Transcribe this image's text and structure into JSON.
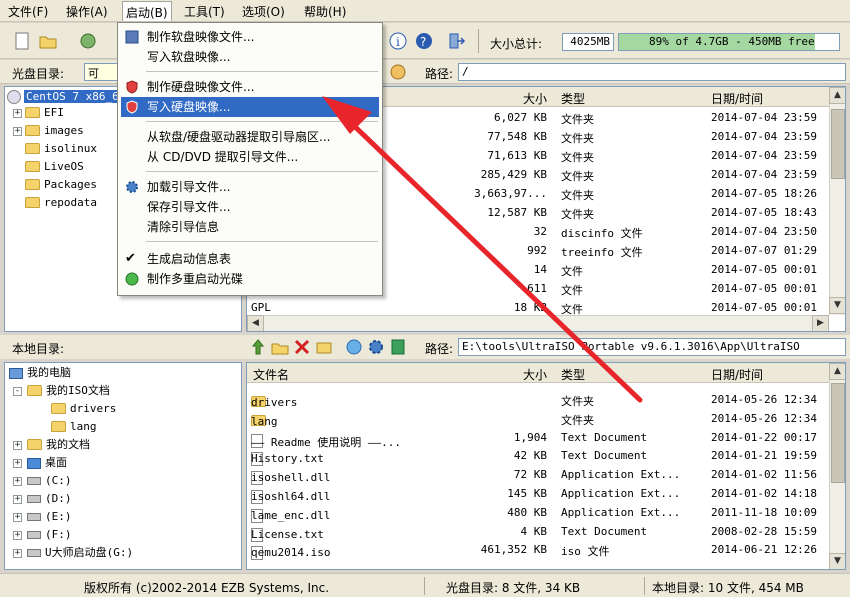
{
  "menubar": {
    "items": [
      "文件(F)",
      "操作(A)",
      "启动(B)",
      "工具(T)",
      "选项(O)",
      "帮助(H)"
    ]
  },
  "toolbar": {
    "size_label": "大小总计:",
    "size_value": "4025MB",
    "capacity_text": "89% of 4.7GB - 450MB free",
    "capacity_fraction": 0.89
  },
  "cd_bar": {
    "label": "光盘目录:",
    "dir_value": "可",
    "path_label": "路径:",
    "path_value": "/"
  },
  "cd_tree": {
    "root": "CentOS 7 x86_6",
    "children": [
      "EFI",
      "images",
      "isolinux",
      "LiveOS",
      "Packages",
      "repodata"
    ]
  },
  "cd_files": {
    "headers": {
      "size": "大小",
      "type": "类型",
      "date": "日期/时间"
    },
    "rows": [
      {
        "name": "",
        "size": "6,027 KB",
        "type": "文件夹",
        "date": "2014-07-04 23:59"
      },
      {
        "name": "",
        "size": "77,548 KB",
        "type": "文件夹",
        "date": "2014-07-04 23:59"
      },
      {
        "name": "",
        "size": "71,613 KB",
        "type": "文件夹",
        "date": "2014-07-04 23:59"
      },
      {
        "name": "",
        "size": "285,429 KB",
        "type": "文件夹",
        "date": "2014-07-04 23:59"
      },
      {
        "name": "",
        "size": "3,663,97...",
        "type": "文件夹",
        "date": "2014-07-05 18:26"
      },
      {
        "name": "",
        "size": "12,587 KB",
        "type": "文件夹",
        "date": "2014-07-05 18:43"
      },
      {
        "name": "",
        "size": "32",
        "type": "discinfo 文件",
        "date": "2014-07-04 23:50"
      },
      {
        "name": "",
        "size": "992",
        "type": "treeinfo 文件",
        "date": "2014-07-07 01:29"
      },
      {
        "name": "",
        "size": "14",
        "type": "文件",
        "date": "2014-07-05 00:01"
      },
      {
        "name": "",
        "size": "611",
        "type": "文件",
        "date": "2014-07-05 00:01"
      },
      {
        "name": "GPL",
        "size": "18 KB",
        "type": "文件",
        "date": "2014-07-05 00:01"
      }
    ]
  },
  "startup_menu": {
    "items": [
      "制作软盘映像文件...",
      "写入软盘映像...",
      "制作硬盘映像文件...",
      "写入硬盘映像...",
      "从软盘/硬盘驱动器提取引导扇区...",
      "从 CD/DVD 提取引导文件...",
      "加载引导文件...",
      "保存引导文件...",
      "清除引导信息",
      "生成启动信息表",
      "制作多重启动光碟"
    ]
  },
  "local_bar": {
    "label": "本地目录:",
    "path_label": "路径:",
    "path_value": "E:\\tools\\UltraISO Portable v9.6.1.3016\\App\\UltraISO"
  },
  "local_tree": {
    "items": [
      "我的电脑",
      "我的ISO文档",
      "drivers",
      "lang",
      "我的文档",
      "桌面",
      "(C:)",
      "(D:)",
      "(E:)",
      "(F:)",
      "U大师启动盘(G:)"
    ]
  },
  "local_files": {
    "headers": {
      "name": "文件名",
      "size": "大小",
      "type": "类型",
      "date": "日期/时间"
    },
    "rows": [
      {
        "name": "drivers",
        "size": "",
        "type": "文件夹",
        "date": "2014-05-26 12:34"
      },
      {
        "name": "lang",
        "size": "",
        "type": "文件夹",
        "date": "2014-05-26 12:34"
      },
      {
        "name": "—— Readme 使用说明 ——...",
        "size": "1,904",
        "type": "Text Document",
        "date": "2014-01-22 00:17"
      },
      {
        "name": "History.txt",
        "size": "42 KB",
        "type": "Text Document",
        "date": "2014-01-21 19:59"
      },
      {
        "name": "isoshell.dll",
        "size": "72 KB",
        "type": "Application Ext...",
        "date": "2014-01-02 11:56"
      },
      {
        "name": "isoshl64.dll",
        "size": "145 KB",
        "type": "Application Ext...",
        "date": "2014-01-02 14:18"
      },
      {
        "name": "lame_enc.dll",
        "size": "480 KB",
        "type": "Application Ext...",
        "date": "2011-11-18 10:09"
      },
      {
        "name": "License.txt",
        "size": "4 KB",
        "type": "Text Document",
        "date": "2008-02-28 15:59"
      },
      {
        "name": "qemu2014.iso",
        "size": "461,352 KB",
        "type": "iso 文件",
        "date": "2014-06-21 12:26"
      }
    ]
  },
  "status": {
    "copyright": "版权所有 (c)2002-2014 EZB Systems, Inc.",
    "cd_info": "光盘目录: 8 文件, 34 KB",
    "local_info": "本地目录: 10 文件, 454 MB"
  },
  "colors": {
    "highlight": "#316ac5",
    "capacity_bar": "#a5d8a0",
    "arrow": "#e8252b"
  }
}
